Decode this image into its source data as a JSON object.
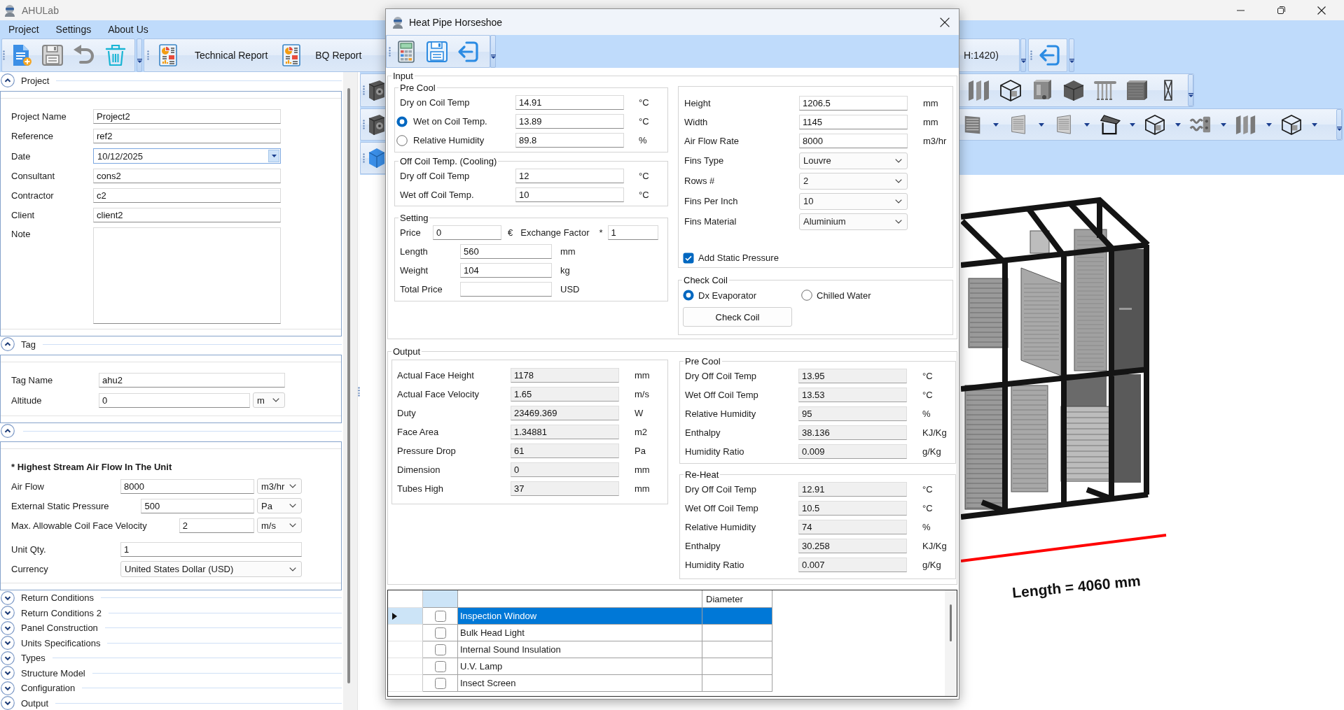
{
  "window": {
    "title": "AHULab"
  },
  "menu": [
    "Project",
    "Settings",
    "About Us"
  ],
  "toolbar": {
    "report_buttons": [
      "Technical Report",
      "BQ Report"
    ],
    "size_label": "H:1420)"
  },
  "project_panel": {
    "sections": [
      {
        "title": "Project",
        "expanded": true,
        "fields": [
          {
            "kind": "text",
            "label": "Project Name",
            "value": "Project2"
          },
          {
            "kind": "text",
            "label": "Reference",
            "value": "ref2"
          },
          {
            "kind": "date",
            "label": "Date",
            "value": "10/12/2025"
          },
          {
            "kind": "text",
            "label": "Consultant",
            "value": "cons2"
          },
          {
            "kind": "text",
            "label": "Contractor",
            "value": "c2"
          },
          {
            "kind": "text",
            "label": "Client",
            "value": "client2"
          },
          {
            "kind": "note",
            "label": "Note"
          }
        ]
      },
      {
        "title": "Tag",
        "expanded": true,
        "fields": [
          {
            "kind": "text",
            "label": "Tag Name",
            "value": "ahu2"
          },
          {
            "kind": "unit",
            "label": "Altitude",
            "value": "0",
            "unit": "m"
          }
        ]
      },
      {
        "expanded": true,
        "fields": [
          {
            "kind": "heading",
            "text": "* Highest Stream Air Flow In The Unit"
          },
          {
            "kind": "unit",
            "label": "Air Flow",
            "value": "8000",
            "unit": "m3/hr"
          },
          {
            "kind": "unit",
            "label": "External Static Pressure",
            "value": "500",
            "unit": "Pa"
          },
          {
            "kind": "unit",
            "label": "Max. Allowable Coil Face Velocity",
            "value": "2",
            "unit": "m/s"
          },
          {
            "kind": "text",
            "label": "Unit Qty.",
            "value": "1"
          },
          {
            "kind": "select",
            "label": "Currency",
            "value": "United States Dollar (USD)"
          }
        ]
      },
      {
        "title": "Return Conditions",
        "expanded": false
      },
      {
        "title": "Return Conditions 2",
        "expanded": false
      },
      {
        "title": "Panel Construction",
        "expanded": false
      },
      {
        "title": "Units Specifications",
        "expanded": false
      },
      {
        "title": "Types",
        "expanded": false
      },
      {
        "title": "Structure Model",
        "expanded": false
      },
      {
        "title": "Configuration",
        "expanded": false
      },
      {
        "title": "Output",
        "expanded": false
      }
    ]
  },
  "dialog": {
    "title": "Heat Pipe Horseshoe",
    "input": {
      "title": "Input",
      "pre_cool": {
        "title": "Pre Cool",
        "rows": [
          {
            "kind": "label",
            "label": "Dry on Coil Temp",
            "value": "14.91",
            "unit": "°C"
          },
          {
            "kind": "radio",
            "label": "Wet on Coil Temp.",
            "selected": true,
            "value": "13.89",
            "unit": "°C"
          },
          {
            "kind": "radio",
            "label": "Relative Humidity",
            "selected": false,
            "value": "89.8",
            "unit": "%"
          }
        ]
      },
      "off_coil": {
        "title": "Off Coil Temp. (Cooling)",
        "rows": [
          {
            "label": "Dry off Coil Temp",
            "value": "12",
            "unit": "°C"
          },
          {
            "label": "Wet off Coil Temp.",
            "value": "10",
            "unit": "°C"
          }
        ]
      },
      "setting": {
        "title": "Setting",
        "price": {
          "label": "Price",
          "value": "0",
          "currency": "€"
        },
        "exchange_factor": {
          "label": "Exchange Factor",
          "marker": "*",
          "value": "1"
        },
        "rows": [
          {
            "label": "Length",
            "value": "560",
            "unit": "mm"
          },
          {
            "label": "Weight",
            "value": "104",
            "unit": "kg"
          },
          {
            "label": "Total Price",
            "unit": "USD"
          }
        ]
      },
      "coil": {
        "rows": [
          {
            "kind": "text",
            "label": "Height",
            "value": "1206.5",
            "unit": "mm"
          },
          {
            "kind": "text",
            "label": "Width",
            "value": "1145",
            "unit": "mm"
          },
          {
            "kind": "text",
            "label": "Air Flow Rate",
            "value": "8000",
            "unit": "m3/hr"
          },
          {
            "kind": "select",
            "label": "Fins Type",
            "value": "Louvre"
          },
          {
            "kind": "select",
            "label": "Rows #",
            "value": "2"
          },
          {
            "kind": "select",
            "label": "Fins Per Inch",
            "value": "10"
          },
          {
            "kind": "select",
            "label": "Fins Material",
            "value": "Aluminium"
          }
        ],
        "static_pressure": {
          "label": "Add Static Pressure",
          "checked": true
        }
      },
      "check_coil": {
        "title": "Check Coil",
        "options": [
          {
            "label": "Dx Evaporator",
            "selected": true
          },
          {
            "label": "Chilled Water",
            "selected": false
          }
        ],
        "button": "Check Coil"
      }
    },
    "output": {
      "title": "Output",
      "results": [
        {
          "label": "Actual Face Height",
          "value": "1178",
          "unit": "mm"
        },
        {
          "label": "Actual Face Velocity",
          "value": "1.65",
          "unit": "m/s"
        },
        {
          "label": "Duty",
          "value": "23469.369",
          "unit": "W"
        },
        {
          "label": "Face Area",
          "value": "1.34881",
          "unit": "m2"
        },
        {
          "label": "Pressure Drop",
          "value": "61",
          "unit": "Pa"
        },
        {
          "label": "Dimension",
          "value": "0",
          "unit": "mm"
        },
        {
          "label": "Tubes High",
          "value": "37",
          "unit": "mm"
        }
      ],
      "pre_cool": {
        "title": "Pre Cool",
        "rows": [
          {
            "label": "Dry Off Coil Temp",
            "value": "13.95",
            "unit": "°C"
          },
          {
            "label": "Wet Off Coil Temp",
            "value": "13.53",
            "unit": "°C"
          },
          {
            "label": "Relative Humidity",
            "value": "95",
            "unit": "%"
          },
          {
            "label": "Enthalpy",
            "value": "38.136",
            "unit": "KJ/Kg"
          },
          {
            "label": "Humidity Ratio",
            "value": "0.009",
            "unit": "g/Kg"
          }
        ]
      },
      "re_heat": {
        "title": "Re-Heat",
        "rows": [
          {
            "label": "Dry Off Coil Temp",
            "value": "12.91",
            "unit": "°C"
          },
          {
            "label": "Wet Off Coil Temp",
            "value": "10.5",
            "unit": "°C"
          },
          {
            "label": "Relative Humidity",
            "value": "74",
            "unit": "%"
          },
          {
            "label": "Enthalpy",
            "value": "30.258",
            "unit": "KJ/Kg"
          },
          {
            "label": "Humidity Ratio",
            "value": "0.007",
            "unit": "g/Kg"
          }
        ]
      }
    },
    "accessories": {
      "diameter_column": "Diameter",
      "rows": [
        {
          "name": "Inspection Window",
          "checked": false,
          "selected": true
        },
        {
          "name": "Bulk Head Light",
          "checked": false,
          "selected": false
        },
        {
          "name": "Internal Sound Insulation",
          "checked": false,
          "selected": false
        },
        {
          "name": "U.V. Lamp",
          "checked": false,
          "selected": false
        },
        {
          "name": "Insect Screen",
          "checked": false,
          "selected": false
        }
      ]
    }
  },
  "model_view": {
    "dimension_label": "Length = 4060 mm"
  }
}
